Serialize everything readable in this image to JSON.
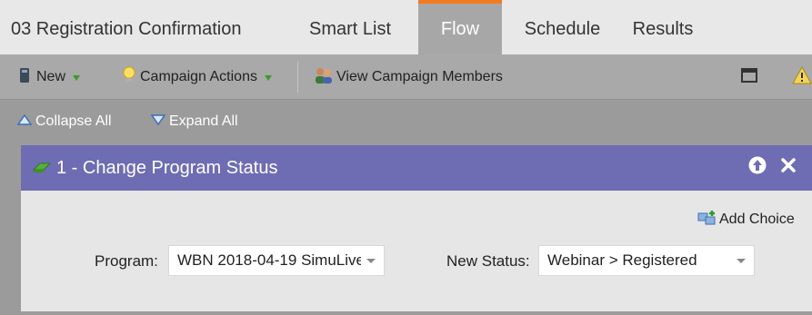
{
  "tabs": [
    {
      "label": "03 Registration Confirmation"
    },
    {
      "label": "Smart List"
    },
    {
      "label": "Flow",
      "active": true
    },
    {
      "label": "Schedule"
    },
    {
      "label": "Results"
    }
  ],
  "toolbar": {
    "new_label": "New",
    "campaign_actions_label": "Campaign Actions",
    "view_members_label": "View Campaign Members"
  },
  "controls": {
    "collapse_all": "Collapse All",
    "expand_all": "Expand All"
  },
  "step": {
    "title": "1 - Change Program Status",
    "add_choice": "Add Choice",
    "program_label": "Program:",
    "program_value": "WBN 2018-04-19 SimuLive",
    "status_label": "New Status:",
    "status_value": "Webinar > Registered"
  },
  "colors": {
    "active_tab_accent": "#f47a20",
    "step_header": "#6e6cb2",
    "dropdown_caret": "#3c9a2a"
  }
}
